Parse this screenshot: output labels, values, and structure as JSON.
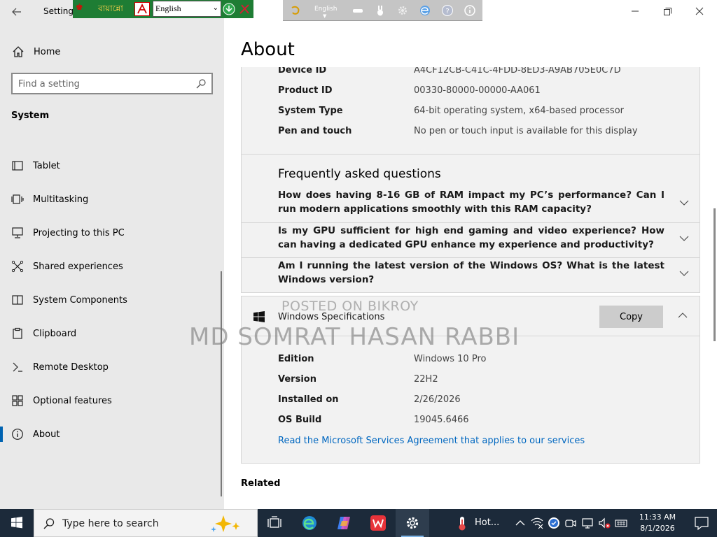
{
  "window": {
    "title": "Settings",
    "heading": "About"
  },
  "sidebar": {
    "home_label": "Home",
    "search_placeholder": "Find a setting",
    "section_heading": "System",
    "items": [
      {
        "label": "Tablet",
        "icon": "tablet-icon"
      },
      {
        "label": "Multitasking",
        "icon": "multitasking-icon"
      },
      {
        "label": "Projecting to this PC",
        "icon": "projecting-icon"
      },
      {
        "label": "Shared experiences",
        "icon": "shared-experiences-icon"
      },
      {
        "label": "System Components",
        "icon": "system-components-icon"
      },
      {
        "label": "Clipboard",
        "icon": "clipboard-icon"
      },
      {
        "label": "Remote Desktop",
        "icon": "remote-desktop-icon"
      },
      {
        "label": "Optional features",
        "icon": "optional-features-icon"
      },
      {
        "label": "About",
        "icon": "info-icon",
        "selected": true
      }
    ]
  },
  "device_specs": [
    {
      "label": "Device ID",
      "value": "A4CF12CB-C41C-4FDD-8ED3-A9AB705E0C7D"
    },
    {
      "label": "Product ID",
      "value": "00330-80000-00000-AA061"
    },
    {
      "label": "System Type",
      "value": "64-bit operating system, x64-based processor"
    },
    {
      "label": "Pen and touch",
      "value": "No pen or touch input is available for this display"
    }
  ],
  "faq": {
    "title": "Frequently asked questions",
    "items": [
      "How does having 8-16 GB of RAM impact my PC’s performance? Can I run modern applications smoothly with this RAM capacity?",
      "Is my GPU sufficient for high end gaming and video experience? How can having a dedicated GPU enhance my experience and productivity?",
      "Am I running the latest version of the Windows OS? What is the latest Windows version?"
    ]
  },
  "windows_specs": {
    "title": "Windows Specifications",
    "copy_label": "Copy",
    "rows": [
      {
        "label": "Edition",
        "value": "Windows 10 Pro"
      },
      {
        "label": "Version",
        "value": "22H2"
      },
      {
        "label": "Installed on",
        "value": "2/26/2026"
      },
      {
        "label": "OS Build",
        "value": "19045.6466"
      }
    ],
    "link": "Read the Microsoft Services Agreement that applies to our services"
  },
  "related_heading": "Related",
  "watermark": {
    "small": "POSTED ON BIKROY",
    "big": "MD SOMRAT HASAN RABBI"
  },
  "bijoy_toolbar": {
    "title": "বায়ান্নো",
    "language": "English"
  },
  "language_bar": {
    "language": "English"
  },
  "taskbar": {
    "search_placeholder": "Type here to search",
    "weather_label": "Hot...",
    "time": "11:33 AM",
    "date": "8/1/2026"
  },
  "colors": {
    "accent": "#0063b1",
    "link": "#0067c0",
    "taskbar": "#1c2a3a",
    "sidebar_bg": "#e9e9e9",
    "panel_bg": "#f2f2f2"
  }
}
